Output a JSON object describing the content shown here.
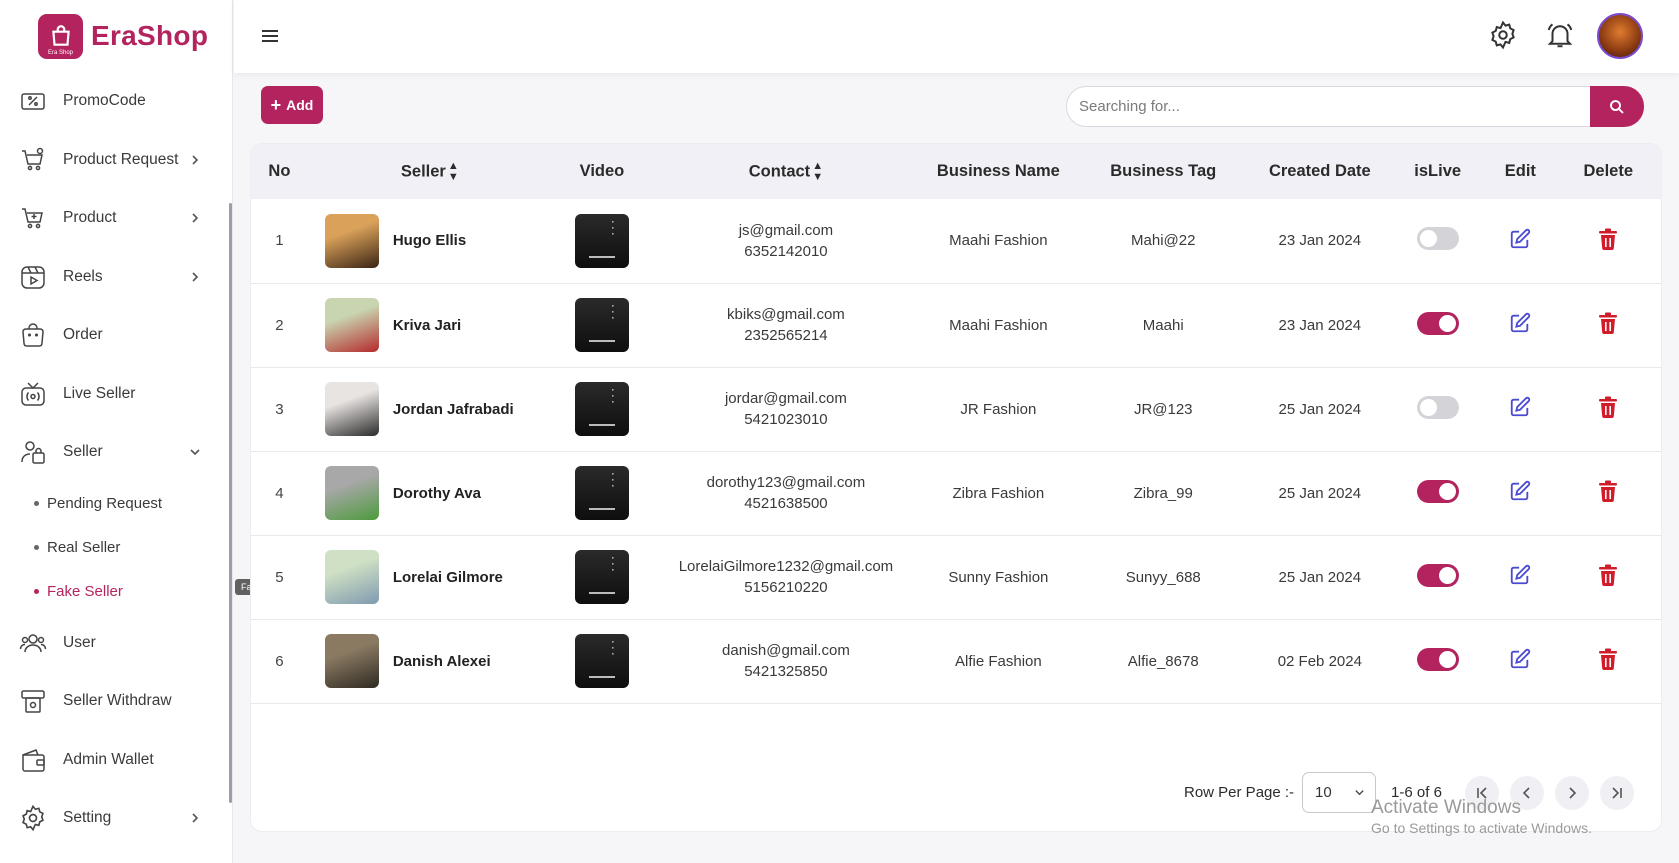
{
  "brand": {
    "name": "EraShop",
    "logo_text": "Era Shop"
  },
  "sidebar": {
    "items": [
      {
        "label": "PromoCode",
        "icon": "promo-code-icon",
        "chevron": ""
      },
      {
        "label": "Product Request",
        "icon": "cart-request-icon",
        "chevron": "right"
      },
      {
        "label": "Product",
        "icon": "cart-add-icon",
        "chevron": "right"
      },
      {
        "label": "Reels",
        "icon": "reels-icon",
        "chevron": "right"
      },
      {
        "label": "Order",
        "icon": "shopping-bag-icon",
        "chevron": ""
      },
      {
        "label": "Live Seller",
        "icon": "live-tv-icon",
        "chevron": ""
      },
      {
        "label": "Seller",
        "icon": "seller-icon",
        "chevron": "down"
      }
    ],
    "sub_items": [
      {
        "label": "Pending Request",
        "active": false
      },
      {
        "label": "Real Seller",
        "active": false
      },
      {
        "label": "Fake Seller",
        "active": true
      }
    ],
    "bottom_items": [
      {
        "label": "User",
        "icon": "users-icon",
        "chevron": ""
      },
      {
        "label": "Seller Withdraw",
        "icon": "withdraw-icon",
        "chevron": ""
      },
      {
        "label": "Admin Wallet",
        "icon": "wallet-icon",
        "chevron": ""
      },
      {
        "label": "Setting",
        "icon": "gear-icon",
        "chevron": "right"
      }
    ],
    "tooltip": "Fake Seller"
  },
  "toolbar": {
    "add_label": "Add"
  },
  "search": {
    "placeholder": "Searching for..."
  },
  "table": {
    "columns": [
      "No",
      "Seller",
      "Video",
      "Contact",
      "Business Name",
      "Business Tag",
      "Created Date",
      "isLive",
      "Edit",
      "Delete"
    ],
    "rows": [
      {
        "no": "1",
        "seller": "Hugo Ellis",
        "email": "js@gmail.com",
        "phone": "6352142010",
        "business_name": "Maahi Fashion",
        "business_tag": "Mahi@22",
        "created": "23 Jan 2024",
        "is_live": false,
        "avatar_colors": [
          "#d9a15a",
          "#3b2414"
        ]
      },
      {
        "no": "2",
        "seller": "Kriva Jari",
        "email": "kbiks@gmail.com",
        "phone": "2352565214",
        "business_name": "Maahi Fashion",
        "business_tag": "Maahi",
        "created": "23 Jan 2024",
        "is_live": true,
        "avatar_colors": [
          "#c9d4b0",
          "#b52a2a"
        ]
      },
      {
        "no": "3",
        "seller": "Jordan Jafrabadi",
        "email": "jordar@gmail.com",
        "phone": "5421023010",
        "business_name": "JR Fashion",
        "business_tag": "JR@123",
        "created": "25 Jan 2024",
        "is_live": false,
        "avatar_colors": [
          "#e8e4e2",
          "#2a2a2a"
        ]
      },
      {
        "no": "4",
        "seller": "Dorothy Ava",
        "email": "dorothy123@gmail.com",
        "phone": "4521638500",
        "business_name": "Zibra Fashion",
        "business_tag": "Zibra_99",
        "created": "25 Jan 2024",
        "is_live": true,
        "avatar_colors": [
          "#a8a8a8",
          "#4d9a3c"
        ]
      },
      {
        "no": "5",
        "seller": "Lorelai Gilmore",
        "email": "LorelaiGilmore1232@gmail.com",
        "phone": "5156210220",
        "business_name": "Sunny Fashion",
        "business_tag": "Sunyy_688",
        "created": "25 Jan 2024",
        "is_live": true,
        "avatar_colors": [
          "#cfe0c4",
          "#7f9ab0"
        ]
      },
      {
        "no": "6",
        "seller": "Danish Alexei",
        "email": "danish@gmail.com",
        "phone": "5421325850",
        "business_name": "Alfie Fashion",
        "business_tag": "Alfie_8678",
        "created": "02 Feb 2024",
        "is_live": true,
        "avatar_colors": [
          "#8a7a62",
          "#2f2a22"
        ]
      }
    ]
  },
  "pagination": {
    "rows_per_page_label": "Row Per Page :-",
    "rows_per_page_value": "10",
    "range": "1-6 of 6"
  },
  "watermark": {
    "line1": "Activate Windows",
    "line2": "Go to Settings to activate Windows."
  },
  "colors": {
    "accent": "#b3245e",
    "edit": "#4b4bd0",
    "delete": "#d11c2c"
  }
}
